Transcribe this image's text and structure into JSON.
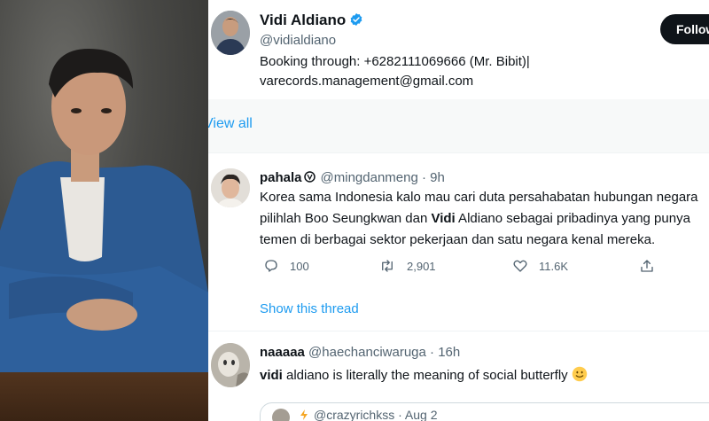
{
  "profile": {
    "name": "Vidi Aldiano",
    "handle": "@vidialdiano",
    "bio_line1": "Booking through: +6282111069666 (Mr. Bibit)|",
    "bio_line2": "varecords.management@gmail.com",
    "follow_label": "Follow"
  },
  "view_all_label": "View all",
  "tweet1": {
    "name": "pahala",
    "handle": "@mingdanmeng",
    "time": "· 9h",
    "line1": "Korea sama Indonesia kalo mau cari duta persahabatan hubungan negara",
    "line2_pre": "pilihlah Boo Seungkwan dan ",
    "line2_bold": "Vidi",
    "line2_post": " Aldiano sebagai pribadinya yang punya",
    "line3": "temen di berbagai sektor pekerjaan dan satu negara kenal mereka.",
    "replies": "100",
    "retweets": "2,901",
    "likes": "11.6K",
    "show_thread_label": "Show this thread"
  },
  "tweet2": {
    "name": "naaaaa",
    "handle": "@haechanciwaruga",
    "time": "· 16h",
    "text_bold": "vidi",
    "text_rest": " aldiano is literally the meaning of social butterfly",
    "quote_handle": "@crazyrichkss",
    "quote_time": "· Aug 2"
  },
  "icons": [
    "verified-badge-icon",
    "reply-icon",
    "retweet-icon",
    "like-icon",
    "share-icon",
    "slightly-smiling-emoji"
  ],
  "colors": {
    "accent": "#1d9bf0",
    "text": "#0f1419",
    "muted": "#536471"
  }
}
